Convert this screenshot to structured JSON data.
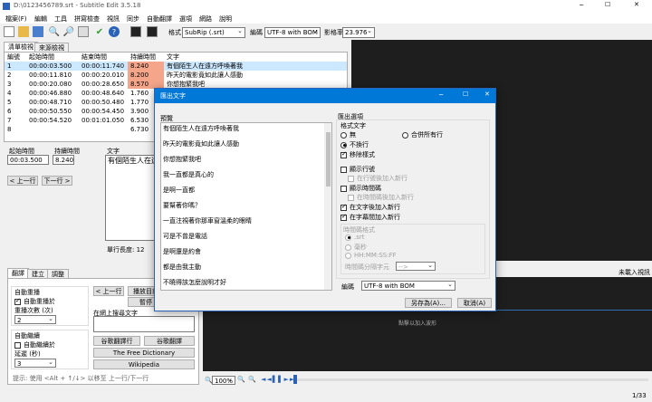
{
  "window": {
    "title": "D:\\0123456789.srt - Subtitle Edit 3.5.18"
  },
  "menu": [
    "檔案(F)",
    "編輯",
    "工具",
    "拼寫檢查",
    "視訊",
    "同步",
    "自動翻譯",
    "選項",
    "網路",
    "說明"
  ],
  "toolbar": {
    "format_label": "格式",
    "format_value": "SubRip (.srt)",
    "encoding_label": "編碼",
    "encoding_value": "UTF-8 with BOM",
    "fps_label": "影格率",
    "fps_value": "23.976"
  },
  "tabs": [
    "清單檢視",
    "來源檢視"
  ],
  "grid": {
    "headers": [
      "編號",
      "起始時間",
      "結束時間",
      "持續時間",
      "文字"
    ],
    "rows": [
      [
        "1",
        "00:00:03.500",
        "00:00:11.740",
        "8.240",
        "有個陌生人在遠方呼喚著我"
      ],
      [
        "2",
        "00:00:11.810",
        "00:00:20.010",
        "8.200",
        "昨天的電影竟如此讓人感動"
      ],
      [
        "3",
        "00:00:20.080",
        "00:00:28.650",
        "8.570",
        "你想抱緊我吧"
      ],
      [
        "4",
        "00:00:46.880",
        "00:00:48.640",
        "1.760",
        ""
      ],
      [
        "5",
        "00:00:48.710",
        "00:00:50.480",
        "1.770",
        ""
      ],
      [
        "6",
        "00:00:50.550",
        "00:00:54.450",
        "3.900",
        ""
      ],
      [
        "7",
        "00:00:54.520",
        "00:01:01.050",
        "6.530",
        ""
      ],
      [
        "8",
        "",
        "",
        "6.730",
        ""
      ]
    ]
  },
  "editor": {
    "start_label": "起始時間",
    "duration_label": "持續時間",
    "text_label": "文字",
    "start_value": "00:03.500",
    "duration_value": "8.240",
    "text_value": "有個陌生人在遠方",
    "prev": "< 上一行",
    "next": "下一行 >",
    "line_length": "單行長度: 12"
  },
  "bottom_tabs": [
    "翻譯",
    "建立",
    "調整"
  ],
  "bottom": {
    "auto_repeat": "自動重播",
    "auto_repeat_on": "自動重播於",
    "repeat_count_label": "重播次數 (次)",
    "repeat_count": "2",
    "auto_continue": "自動繼續",
    "auto_continue_on": "自動繼續於",
    "delay_label": "延遲 (秒)",
    "delay": "3",
    "prev_line": "< 上一行",
    "play_current": "播放目前",
    "pause": "暫停",
    "search_label": "在網上搜尋文字",
    "google_lang_btn": "谷歌翻譯行",
    "google_btn": "谷歌翻譯",
    "dict_btn": "The Free Dictionary",
    "wiki_btn": "Wikipedia",
    "hint": "提示: 使用 <Alt + ↑/↓> 以移至 上一行/下一行"
  },
  "video": {
    "panel_label": "未載入視訊",
    "waveform_hint": "點擊以加入波形",
    "zoom": "100%",
    "count": "1/33"
  },
  "dialog": {
    "title": "匯出文字",
    "preview_label": "預覽",
    "preview_lines": [
      "有個陌生人在遠方呼喚著我",
      "昨天的電影竟如此讓人感動",
      "你想抱緊我吧",
      "我一直都是真心的",
      "是啊一直都",
      "要幫著你嗎？",
      "一直注視著你那車窗溫柔的眼睛",
      "可是不曾是電話",
      "是啊還是約會",
      "都是由我主動",
      "不曉得該怎麼說明才好"
    ],
    "options_label": "匯出選項",
    "format_text_label": "格式文字",
    "radio_none": "無",
    "radio_merge": "合併所有行",
    "radio_unbreak": "不換行",
    "remove_style": "移除樣式",
    "show_line_numbers": "顯示行號",
    "add_newline_after_numbers": "在行號後加入新行",
    "show_timecodes": "顯示時間碼",
    "add_newline_after_timecodes": "在時間碼後加入新行",
    "add_newline_after_text": "在文字後加入新行",
    "add_newline_after_lines": "在字幕間加入新行",
    "timecode_format_label": "時間碼格式",
    "tc_srt": ".srt",
    "tc_ms": "毫秒",
    "tc_hhmmss": "HH:MM:SS:FF",
    "tc_separator_label": "時間碼分隔字元",
    "tc_separator_value": "-->",
    "encoding_label": "編碼",
    "encoding_value": "UTF-8 with BOM",
    "save_as": "另存為(A)...",
    "cancel": "取消(A)"
  },
  "colors": {
    "selected_row": "#cce8ff",
    "duration_warn": "#f4a58a",
    "dialog_title": "#0078d7",
    "video_bg": "#1e1e1e"
  }
}
